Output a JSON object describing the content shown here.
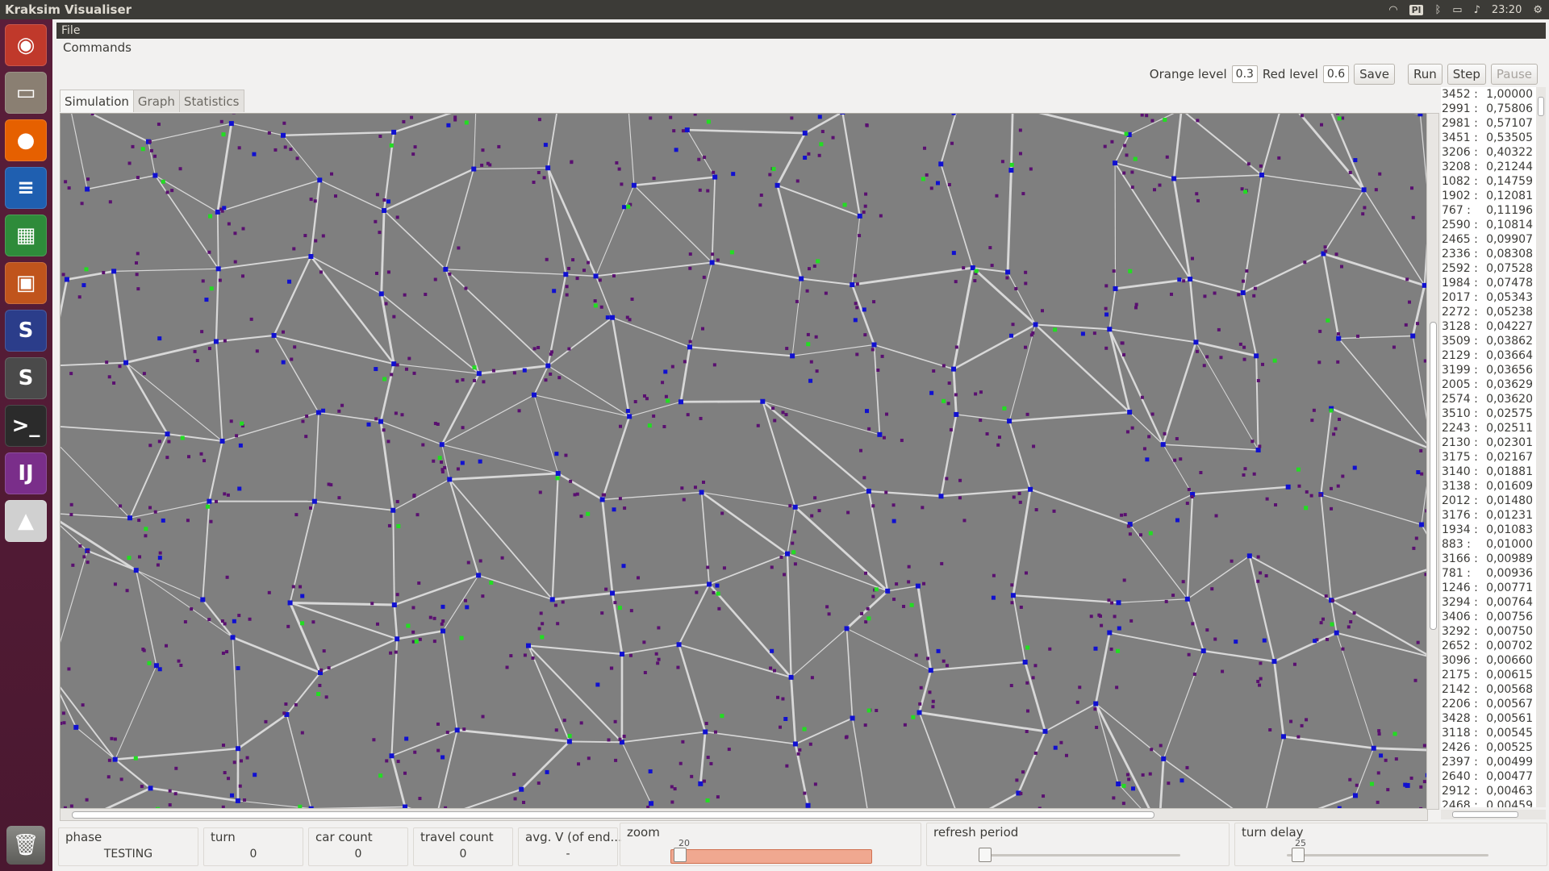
{
  "window": {
    "title": "Kraksim Visualiser"
  },
  "tray": {
    "keyboard": "Pl",
    "time": "23:20",
    "wifi_icon": "wifi-icon",
    "bluetooth_icon": "bluetooth-icon",
    "battery_icon": "battery-icon",
    "volume_icon": "volume-icon",
    "settings_icon": "gear-icon"
  },
  "launcher": [
    {
      "name": "ubuntu-home-icon",
      "glyph": "◉",
      "color": "#c0392b"
    },
    {
      "name": "files-icon",
      "glyph": "▭",
      "color": "#8a7f72"
    },
    {
      "name": "firefox-icon",
      "glyph": "●",
      "color": "#e66000"
    },
    {
      "name": "writer-icon",
      "glyph": "≡",
      "color": "#1f5fb0"
    },
    {
      "name": "calc-icon",
      "glyph": "▦",
      "color": "#2e8b3a"
    },
    {
      "name": "impress-icon",
      "glyph": "▣",
      "color": "#c0541c"
    },
    {
      "name": "app-swirl-icon",
      "glyph": "S",
      "color": "#2b3d8a"
    },
    {
      "name": "sublime-icon",
      "glyph": "S",
      "color": "#4a4a4a"
    },
    {
      "name": "terminal-icon",
      "glyph": ">_",
      "color": "#2b2b2b"
    },
    {
      "name": "intellij-icon",
      "glyph": "IJ",
      "color": "#7a2e8a"
    },
    {
      "name": "java-app-icon",
      "glyph": "▲",
      "color": "#d0d0d0"
    }
  ],
  "menu": {
    "file": "File"
  },
  "commands_label": "Commands",
  "toolbar": {
    "orange_label": "Orange level",
    "orange_value": "0.3",
    "red_label": "Red level",
    "red_value": "0.6",
    "save": "Save",
    "run": "Run",
    "step": "Step",
    "pause": "Pause"
  },
  "tabs": [
    {
      "label": "Simulation",
      "active": true
    },
    {
      "label": "Graph",
      "active": false
    },
    {
      "label": "Statistics",
      "active": false
    }
  ],
  "stats": [
    [
      "3452 :",
      "1,00000"
    ],
    [
      "2991 :",
      "0,75806"
    ],
    [
      "2981 :",
      "0,57107"
    ],
    [
      "3451 :",
      "0,53505"
    ],
    [
      "3206 :",
      "0,40322"
    ],
    [
      "3208 :",
      "0,21244"
    ],
    [
      "1082 :",
      "0,14759"
    ],
    [
      "1902 :",
      "0,12081"
    ],
    [
      "767 :",
      "0,11196"
    ],
    [
      "2590 :",
      "0,10814"
    ],
    [
      "2465 :",
      "0,09907"
    ],
    [
      "2336 :",
      "0,08308"
    ],
    [
      "2592 :",
      "0,07528"
    ],
    [
      "1984 :",
      "0,07478"
    ],
    [
      "2017 :",
      "0,05343"
    ],
    [
      "2272 :",
      "0,05238"
    ],
    [
      "3128 :",
      "0,04227"
    ],
    [
      "3509 :",
      "0,03862"
    ],
    [
      "2129 :",
      "0,03664"
    ],
    [
      "3199 :",
      "0,03656"
    ],
    [
      "2005 :",
      "0,03629"
    ],
    [
      "2574 :",
      "0,03620"
    ],
    [
      "3510 :",
      "0,02575"
    ],
    [
      "2243 :",
      "0,02511"
    ],
    [
      "2130 :",
      "0,02301"
    ],
    [
      "3175 :",
      "0,02167"
    ],
    [
      "3140 :",
      "0,01881"
    ],
    [
      "3138 :",
      "0,01609"
    ],
    [
      "2012 :",
      "0,01480"
    ],
    [
      "3176 :",
      "0,01231"
    ],
    [
      "1934 :",
      "0,01083"
    ],
    [
      "883 :",
      "0,01000"
    ],
    [
      "3166 :",
      "0,00989"
    ],
    [
      "781 :",
      "0,00936"
    ],
    [
      "1246 :",
      "0,00771"
    ],
    [
      "3294 :",
      "0,00764"
    ],
    [
      "3406 :",
      "0,00756"
    ],
    [
      "3292 :",
      "0,00750"
    ],
    [
      "2652 :",
      "0,00702"
    ],
    [
      "3096 :",
      "0,00660"
    ],
    [
      "2175 :",
      "0,00615"
    ],
    [
      "2142 :",
      "0,00568"
    ],
    [
      "2206 :",
      "0,00567"
    ],
    [
      "3428 :",
      "0,00561"
    ],
    [
      "3118 :",
      "0,00545"
    ],
    [
      "2426 :",
      "0,00525"
    ],
    [
      "2397 :",
      "0,00499"
    ],
    [
      "2640 :",
      "0,00477"
    ],
    [
      "2912 :",
      "0,00463"
    ],
    [
      "2468 :",
      "0,00459"
    ]
  ],
  "status": {
    "phase_label": "phase",
    "phase_value": "TESTING",
    "turn_label": "turn",
    "turn_value": "0",
    "car_count_label": "car count",
    "car_count_value": "0",
    "travel_count_label": "travel count",
    "travel_count_value": "0",
    "avgv_label": "avg. V (of end...",
    "avgv_value": "-",
    "zoom_label": "zoom",
    "zoom_tick": "20",
    "refresh_label": "refresh period",
    "turn_delay_label": "turn delay",
    "turn_delay_tick": "25"
  },
  "colors": {
    "node": "#1010d0",
    "source": "#22dd22",
    "marker": "#5a1070",
    "road": "#d8d8d8",
    "canvas_bg": "#7f7f7f"
  }
}
